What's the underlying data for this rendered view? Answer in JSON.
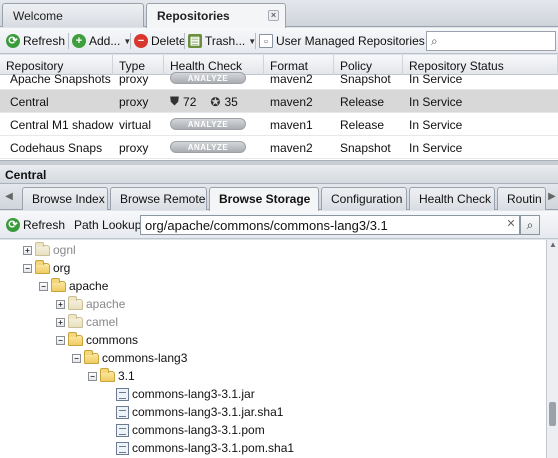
{
  "top_tabs": {
    "welcome": "Welcome",
    "repositories": "Repositories",
    "close": "×"
  },
  "toolbar": {
    "refresh": "Refresh",
    "add": "Add...",
    "delete": "Delete",
    "trash": "Trash...",
    "user_managed": "User Managed Repositories",
    "search_placeholder": ""
  },
  "grid": {
    "headers": [
      "Repository",
      "Type",
      "Health Check",
      "Format",
      "Policy",
      "Repository Status"
    ],
    "analyze_label": "ANALYZE",
    "rows": [
      {
        "name": "Apache Snapshots",
        "type": "proxy",
        "health": "analyze",
        "format": "maven2",
        "policy": "Snapshot",
        "status": "In Service"
      },
      {
        "name": "Central",
        "type": "proxy",
        "health_count_security": "72",
        "health_count_license": "35",
        "format": "maven2",
        "policy": "Release",
        "status": "In Service"
      },
      {
        "name": "Central M1 shadow",
        "type": "virtual",
        "health": "analyze",
        "format": "maven1",
        "policy": "Release",
        "status": "In Service"
      },
      {
        "name": "Codehaus Snaps",
        "type": "proxy",
        "health": "analyze",
        "format": "maven2",
        "policy": "Snapshot",
        "status": "In Service"
      }
    ]
  },
  "central": {
    "title": "Central",
    "tabs": [
      "Browse Index",
      "Browse Remote",
      "Browse Storage",
      "Configuration",
      "Health Check",
      "Routin"
    ]
  },
  "storage": {
    "refresh": "Refresh",
    "path_label": "Path Lookup:",
    "path_value": "org/apache/commons/commons-lang3/3.1"
  },
  "tree": [
    {
      "label": "ognl",
      "kind": "folder",
      "state": "collapsed",
      "muted": true,
      "level": 0
    },
    {
      "label": "org",
      "kind": "folder",
      "state": "expanded",
      "muted": false,
      "level": 0
    },
    {
      "label": "apache",
      "kind": "folder",
      "state": "expanded",
      "muted": false,
      "level": 1
    },
    {
      "label": "apache",
      "kind": "folder",
      "state": "collapsed",
      "muted": true,
      "level": 2
    },
    {
      "label": "camel",
      "kind": "folder",
      "state": "collapsed",
      "muted": true,
      "level": 2
    },
    {
      "label": "commons",
      "kind": "folder",
      "state": "expanded",
      "muted": false,
      "level": 2
    },
    {
      "label": "commons-lang3",
      "kind": "folder",
      "state": "expanded",
      "muted": false,
      "level": 3
    },
    {
      "label": "3.1",
      "kind": "folder",
      "state": "expanded",
      "muted": false,
      "level": 4
    },
    {
      "label": "commons-lang3-3.1.jar",
      "kind": "file",
      "level": 5
    },
    {
      "label": "commons-lang3-3.1.jar.sha1",
      "kind": "file",
      "level": 5
    },
    {
      "label": "commons-lang3-3.1.pom",
      "kind": "file",
      "level": 5
    },
    {
      "label": "commons-lang3-3.1.pom.sha1",
      "kind": "file",
      "level": 5
    }
  ]
}
